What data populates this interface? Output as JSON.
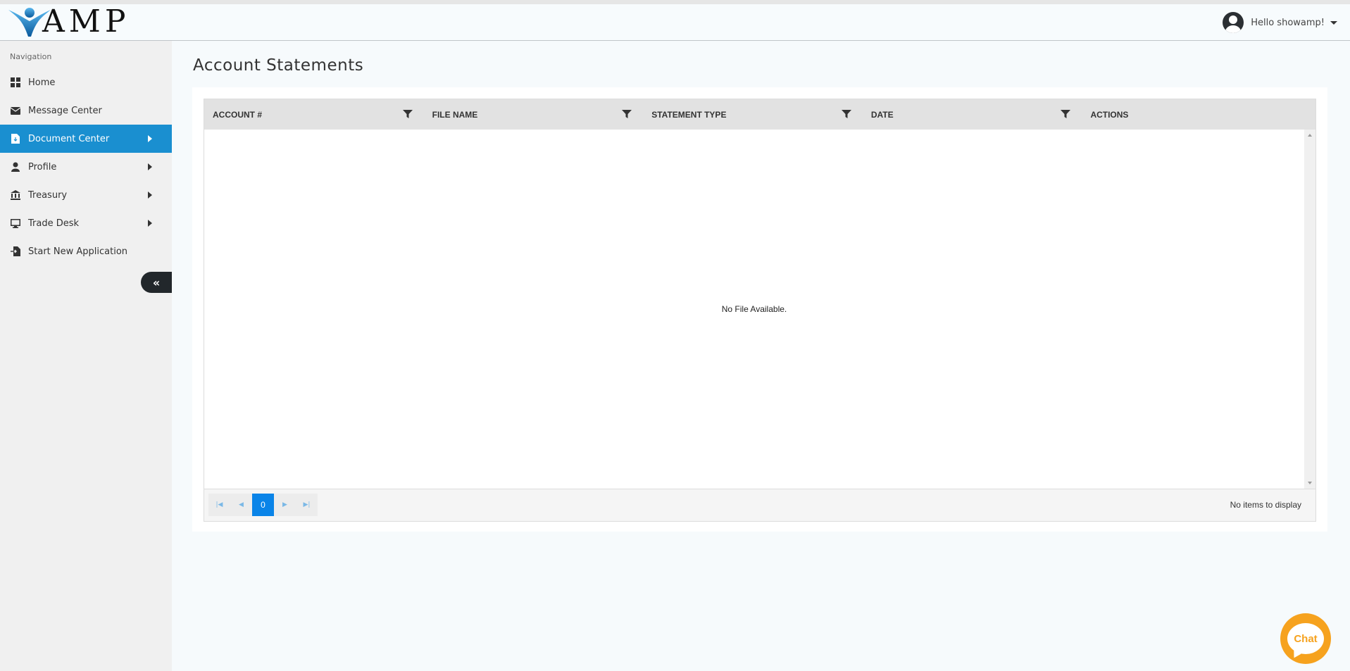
{
  "header": {
    "logo_text": "AMP",
    "greeting": "Hello showamp!"
  },
  "sidebar": {
    "title": "Navigation",
    "items": [
      {
        "label": "Home",
        "icon": "grid-icon",
        "active": false,
        "has_submenu": false
      },
      {
        "label": "Message Center",
        "icon": "envelope-icon",
        "active": false,
        "has_submenu": false
      },
      {
        "label": "Document Center",
        "icon": "document-icon",
        "active": true,
        "has_submenu": true
      },
      {
        "label": "Profile",
        "icon": "user-icon",
        "active": false,
        "has_submenu": true
      },
      {
        "label": "Treasury",
        "icon": "bank-icon",
        "active": false,
        "has_submenu": true
      },
      {
        "label": "Trade Desk",
        "icon": "monitor-icon",
        "active": false,
        "has_submenu": true
      },
      {
        "label": "Start New Application",
        "icon": "new-document-icon",
        "active": false,
        "has_submenu": false
      }
    ],
    "collapse_icon": "double-chevron-left-icon"
  },
  "main": {
    "title": "Account Statements",
    "grid": {
      "columns": [
        "ACCOUNT #",
        "FILE NAME",
        "STATEMENT TYPE",
        "DATE",
        "ACTIONS"
      ],
      "empty_message": "No File Available.",
      "pager": {
        "current_page": "0",
        "info": "No items to display"
      }
    }
  },
  "chat": {
    "label": "Chat"
  },
  "colors": {
    "accent": "#1a8fd0",
    "pager_active": "#0a84e8",
    "chat": "#f6a21e"
  }
}
